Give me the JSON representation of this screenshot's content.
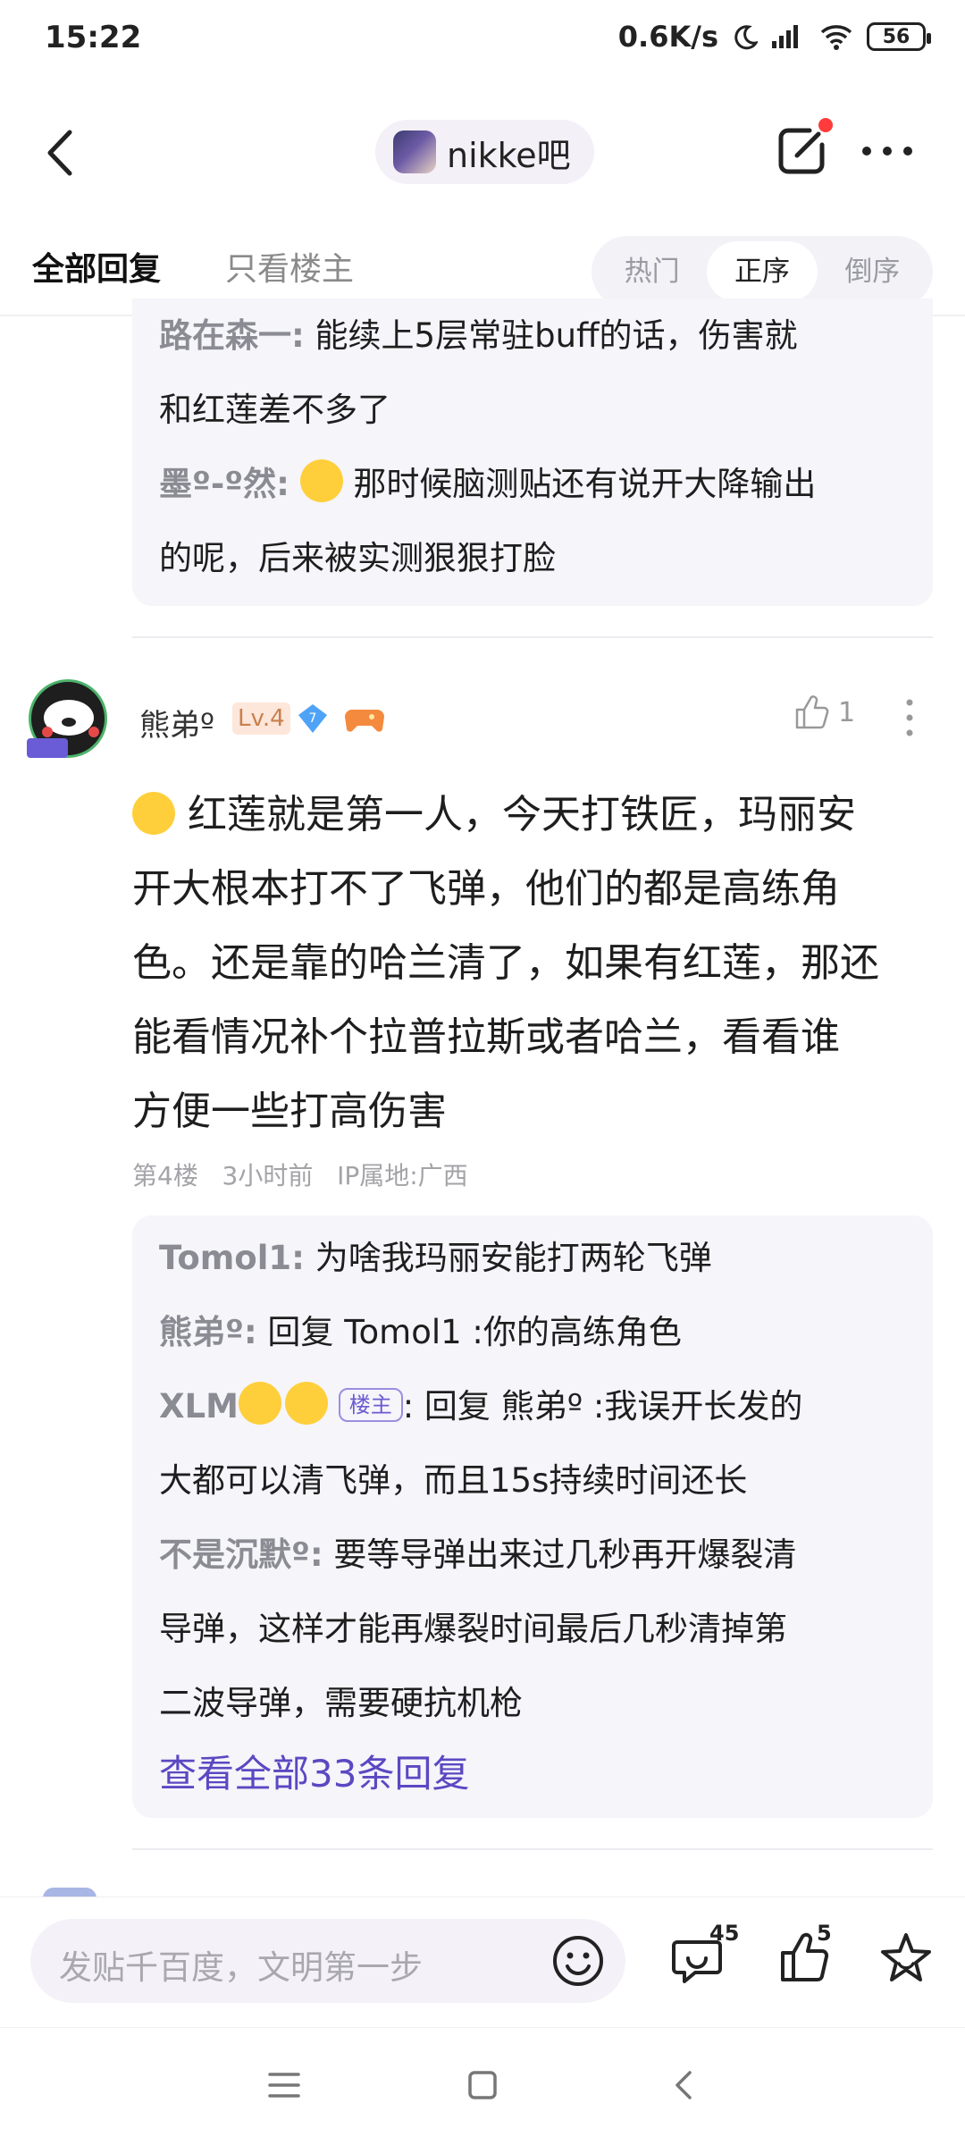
{
  "status": {
    "time": "15:22",
    "speed": "0.6K/s",
    "battery": "56"
  },
  "header": {
    "forum_name": "nikke吧"
  },
  "tabs": {
    "all": "全部回复",
    "owner_only": "只看楼主"
  },
  "sort": {
    "options": [
      "热门",
      "正序",
      "倒序"
    ],
    "selected": "正序"
  },
  "prev_replies": [
    {
      "name": "路在森一:",
      "text": " 能续上5层常驻buff的话，伤害就"
    },
    {
      "name": "",
      "text": "和红莲差不多了"
    },
    {
      "name": "墨º-º然:",
      "text": " 那时候脑测贴还有说开大降输出"
    },
    {
      "name": "",
      "text": "的呢，后来被实测狠狠打脸"
    }
  ],
  "post": {
    "username": "熊弟º",
    "level": "Lv.4",
    "gem_level": "7",
    "likes": "1",
    "content_lines": [
      "红莲就是第一人，今天打铁匠，玛丽安",
      "开大根本打不了飞弹，他们的都是高练角",
      "色。还是靠的哈兰清了，如果有红莲，那还",
      "能看情况补个拉普拉斯或者哈兰，看看谁",
      "方便一些打高伤害"
    ],
    "floor": "第4楼",
    "time": "3小时前",
    "ip": "IP属地:广西"
  },
  "replies": [
    {
      "name": "Tomol1:",
      "text": " 为啥我玛丽安能打两轮飞弹"
    },
    {
      "name": "熊弟º:",
      "text": " 回复 Tomol1 :你的高练角色"
    },
    {
      "name": "XLM",
      "tag": "楼主",
      "text": ": 回复 熊弟º :我误开长发的"
    },
    {
      "name": "",
      "text": "大都可以清飞弹，而且15s持续时间还长"
    },
    {
      "name": "不是沉默º:",
      "text": " 要等导弹出来过几秒再开爆裂清"
    },
    {
      "name": "",
      "text": "导弹，这样才能再爆裂时间最后几秒清掉第"
    },
    {
      "name": "",
      "text": "二波导弹，需要硬抗机枪"
    }
  ],
  "view_all": "查看全部33条回复",
  "bottom": {
    "placeholder": "发贴千百度，文明第一步",
    "comment_count": "45",
    "like_count": "5"
  }
}
